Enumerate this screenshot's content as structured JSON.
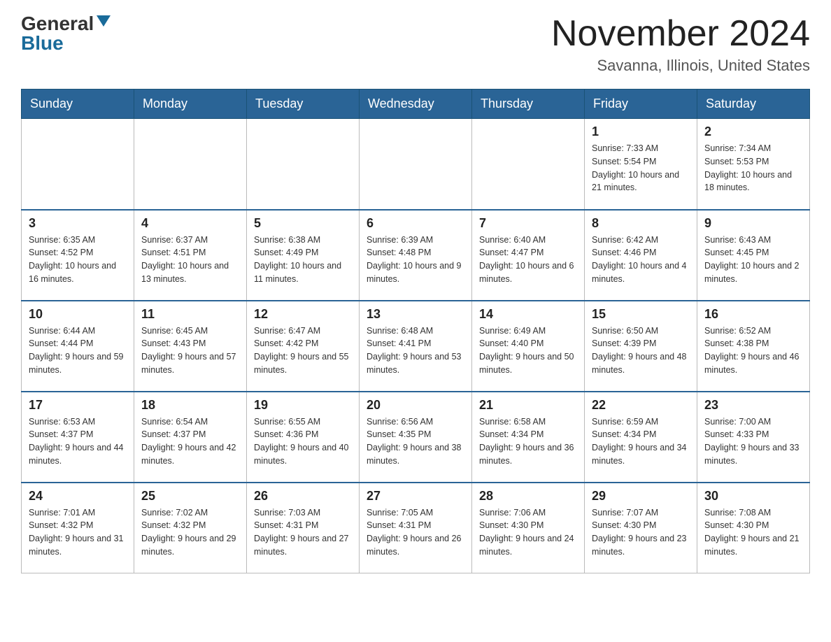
{
  "header": {
    "logo_general": "General",
    "logo_blue": "Blue",
    "month": "November 2024",
    "location": "Savanna, Illinois, United States"
  },
  "days_of_week": [
    "Sunday",
    "Monday",
    "Tuesday",
    "Wednesday",
    "Thursday",
    "Friday",
    "Saturday"
  ],
  "weeks": [
    [
      {
        "day": "",
        "info": ""
      },
      {
        "day": "",
        "info": ""
      },
      {
        "day": "",
        "info": ""
      },
      {
        "day": "",
        "info": ""
      },
      {
        "day": "",
        "info": ""
      },
      {
        "day": "1",
        "info": "Sunrise: 7:33 AM\nSunset: 5:54 PM\nDaylight: 10 hours and 21 minutes."
      },
      {
        "day": "2",
        "info": "Sunrise: 7:34 AM\nSunset: 5:53 PM\nDaylight: 10 hours and 18 minutes."
      }
    ],
    [
      {
        "day": "3",
        "info": "Sunrise: 6:35 AM\nSunset: 4:52 PM\nDaylight: 10 hours and 16 minutes."
      },
      {
        "day": "4",
        "info": "Sunrise: 6:37 AM\nSunset: 4:51 PM\nDaylight: 10 hours and 13 minutes."
      },
      {
        "day": "5",
        "info": "Sunrise: 6:38 AM\nSunset: 4:49 PM\nDaylight: 10 hours and 11 minutes."
      },
      {
        "day": "6",
        "info": "Sunrise: 6:39 AM\nSunset: 4:48 PM\nDaylight: 10 hours and 9 minutes."
      },
      {
        "day": "7",
        "info": "Sunrise: 6:40 AM\nSunset: 4:47 PM\nDaylight: 10 hours and 6 minutes."
      },
      {
        "day": "8",
        "info": "Sunrise: 6:42 AM\nSunset: 4:46 PM\nDaylight: 10 hours and 4 minutes."
      },
      {
        "day": "9",
        "info": "Sunrise: 6:43 AM\nSunset: 4:45 PM\nDaylight: 10 hours and 2 minutes."
      }
    ],
    [
      {
        "day": "10",
        "info": "Sunrise: 6:44 AM\nSunset: 4:44 PM\nDaylight: 9 hours and 59 minutes."
      },
      {
        "day": "11",
        "info": "Sunrise: 6:45 AM\nSunset: 4:43 PM\nDaylight: 9 hours and 57 minutes."
      },
      {
        "day": "12",
        "info": "Sunrise: 6:47 AM\nSunset: 4:42 PM\nDaylight: 9 hours and 55 minutes."
      },
      {
        "day": "13",
        "info": "Sunrise: 6:48 AM\nSunset: 4:41 PM\nDaylight: 9 hours and 53 minutes."
      },
      {
        "day": "14",
        "info": "Sunrise: 6:49 AM\nSunset: 4:40 PM\nDaylight: 9 hours and 50 minutes."
      },
      {
        "day": "15",
        "info": "Sunrise: 6:50 AM\nSunset: 4:39 PM\nDaylight: 9 hours and 48 minutes."
      },
      {
        "day": "16",
        "info": "Sunrise: 6:52 AM\nSunset: 4:38 PM\nDaylight: 9 hours and 46 minutes."
      }
    ],
    [
      {
        "day": "17",
        "info": "Sunrise: 6:53 AM\nSunset: 4:37 PM\nDaylight: 9 hours and 44 minutes."
      },
      {
        "day": "18",
        "info": "Sunrise: 6:54 AM\nSunset: 4:37 PM\nDaylight: 9 hours and 42 minutes."
      },
      {
        "day": "19",
        "info": "Sunrise: 6:55 AM\nSunset: 4:36 PM\nDaylight: 9 hours and 40 minutes."
      },
      {
        "day": "20",
        "info": "Sunrise: 6:56 AM\nSunset: 4:35 PM\nDaylight: 9 hours and 38 minutes."
      },
      {
        "day": "21",
        "info": "Sunrise: 6:58 AM\nSunset: 4:34 PM\nDaylight: 9 hours and 36 minutes."
      },
      {
        "day": "22",
        "info": "Sunrise: 6:59 AM\nSunset: 4:34 PM\nDaylight: 9 hours and 34 minutes."
      },
      {
        "day": "23",
        "info": "Sunrise: 7:00 AM\nSunset: 4:33 PM\nDaylight: 9 hours and 33 minutes."
      }
    ],
    [
      {
        "day": "24",
        "info": "Sunrise: 7:01 AM\nSunset: 4:32 PM\nDaylight: 9 hours and 31 minutes."
      },
      {
        "day": "25",
        "info": "Sunrise: 7:02 AM\nSunset: 4:32 PM\nDaylight: 9 hours and 29 minutes."
      },
      {
        "day": "26",
        "info": "Sunrise: 7:03 AM\nSunset: 4:31 PM\nDaylight: 9 hours and 27 minutes."
      },
      {
        "day": "27",
        "info": "Sunrise: 7:05 AM\nSunset: 4:31 PM\nDaylight: 9 hours and 26 minutes."
      },
      {
        "day": "28",
        "info": "Sunrise: 7:06 AM\nSunset: 4:30 PM\nDaylight: 9 hours and 24 minutes."
      },
      {
        "day": "29",
        "info": "Sunrise: 7:07 AM\nSunset: 4:30 PM\nDaylight: 9 hours and 23 minutes."
      },
      {
        "day": "30",
        "info": "Sunrise: 7:08 AM\nSunset: 4:30 PM\nDaylight: 9 hours and 21 minutes."
      }
    ]
  ]
}
